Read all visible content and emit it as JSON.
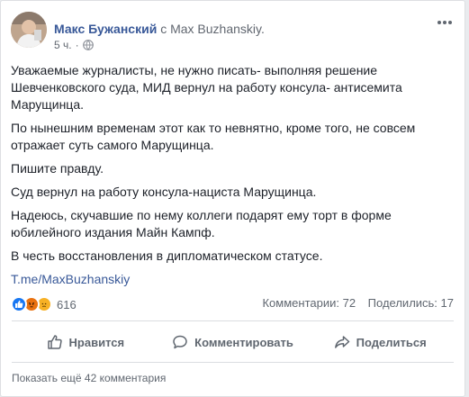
{
  "post": {
    "author_name": "Макс Бужанский",
    "via_word": "с",
    "page_name": "Max Buzhanskiy.",
    "time": "5 ч.",
    "paragraphs": [
      "Уважаемые журналисты, не нужно писать- выполняя решение Шевченковского суда, МИД вернул на работу консула- антисемита Марущинца.",
      "По нынешним временам этот как то невнятно, кроме того, не совсем отражает суть самого Марущинца.",
      "Пишите правду.",
      "Суд вернул на работу консула-нациста Марущинца.",
      "Надеюсь, скучавшие по нему коллеги подарят ему торт в форме юбилейного издания Майн Кампф.",
      "В честь восстановления в дипломатическом статусе."
    ],
    "link": "T.me/MaxBuzhanskiy"
  },
  "stats": {
    "reaction_icons": [
      "like-icon",
      "angry-icon",
      "sad-icon"
    ],
    "reactions_count": "616",
    "comments": "Комментарии: 72",
    "shares": "Поделились: 17"
  },
  "actions": {
    "like": "Нравится",
    "comment": "Комментировать",
    "share": "Поделиться"
  },
  "footer": {
    "more_comments": "Показать ещё 42 комментария"
  },
  "colors": {
    "link": "#385898",
    "like": "#1877f2",
    "angry": "#e9710f",
    "sad": "#f7b125",
    "muted": "#606770"
  }
}
